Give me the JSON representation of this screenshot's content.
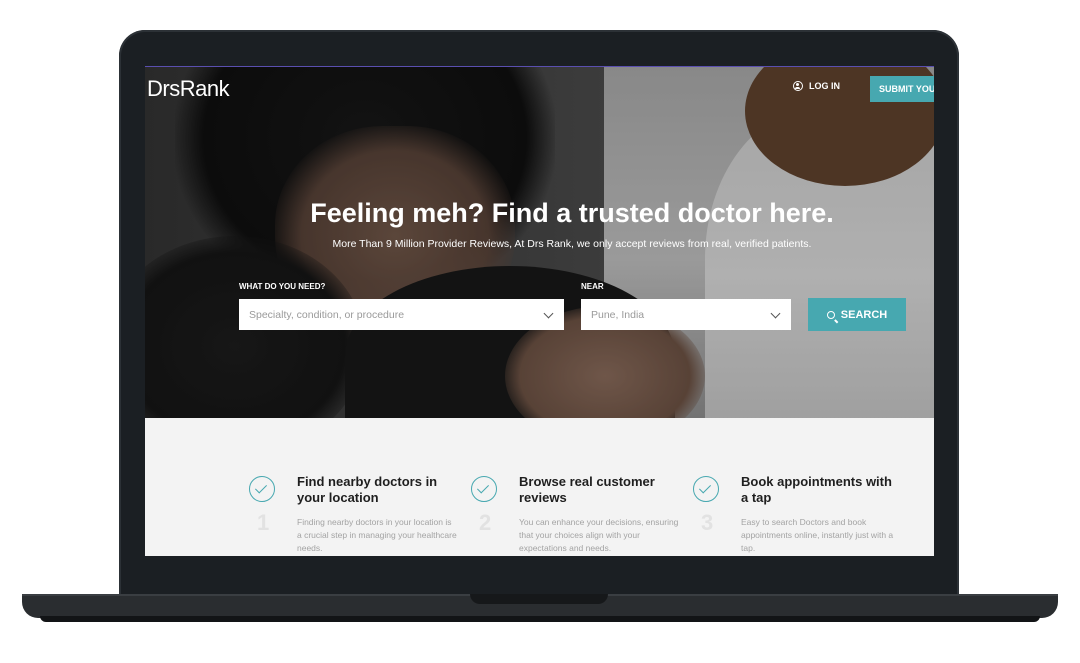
{
  "brand": {
    "logo": "DrsRank",
    "accent": "#47a8b0"
  },
  "nav": {
    "login_label": "LOG IN",
    "submit_label": "SUBMIT YOU"
  },
  "hero": {
    "headline": "Feeling meh? Find a trusted doctor here.",
    "subline": "More Than 9 Million Provider Reviews, At Drs Rank, we only accept reviews from real, verified patients."
  },
  "search": {
    "need_label": "WHAT DO YOU NEED?",
    "need_placeholder": "Specialty, condition, or procedure",
    "near_label": "NEAR",
    "near_value": "Pune, India",
    "button_label": "SEARCH"
  },
  "features": [
    {
      "number": "1",
      "title": "Find nearby doctors in your location",
      "desc": "Finding nearby doctors in your location is a crucial step in managing your healthcare needs."
    },
    {
      "number": "2",
      "title": "Browse real customer reviews",
      "desc": "You can enhance your decisions, ensuring that your choices align with your expectations and needs."
    },
    {
      "number": "3",
      "title": "Book appointments with a tap",
      "desc": "Easy to search Doctors and book appointments online, instantly just with a tap."
    }
  ]
}
